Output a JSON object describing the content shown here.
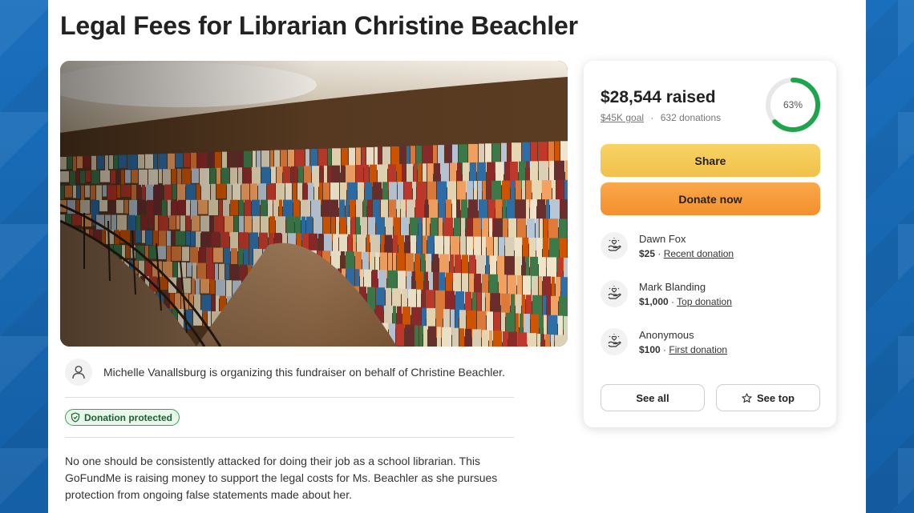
{
  "fundraiser": {
    "title": "Legal Fees for Librarian Christine Beachler",
    "organizer_text": "Michelle Vanallsburg is organizing this fundraiser on behalf of Christine Beachler.",
    "protected_label": "Donation protected",
    "story": "No one should be consistently attacked for doing their job as a school librarian. This GoFundMe is raising money to support the legal costs for Ms. Beachler as she pursues protection from ongoing false statements made about her."
  },
  "card": {
    "raised": "$28,544 raised",
    "goal": "$45K goal",
    "separator": "·",
    "donations_count": "632 donations",
    "progress_label": "63%",
    "progress": 0.63,
    "share_label": "Share",
    "donate_label": "Donate now",
    "donations": [
      {
        "name": "Dawn Fox",
        "amount": "$25",
        "sep": " · ",
        "type": "Recent donation"
      },
      {
        "name": "Mark Blanding",
        "amount": "$1,000",
        "sep": " · ",
        "type": "Top donation"
      },
      {
        "name": "Anonymous",
        "amount": "$100",
        "sep": " · ",
        "type": "First donation"
      }
    ],
    "see_all_label": "See all",
    "see_top_label": "See top"
  },
  "colors": {
    "frame_blue": "#1565b0",
    "progress_green": "#1ea54c",
    "share_yellow": "#f3c54f",
    "donate_orange": "#f59a35",
    "protected_green": "#2fa84f"
  },
  "icons": {
    "organizer": "person-icon",
    "protected": "shield-check-icon",
    "donor": "heart-hand-icon",
    "see_top": "star-icon"
  }
}
